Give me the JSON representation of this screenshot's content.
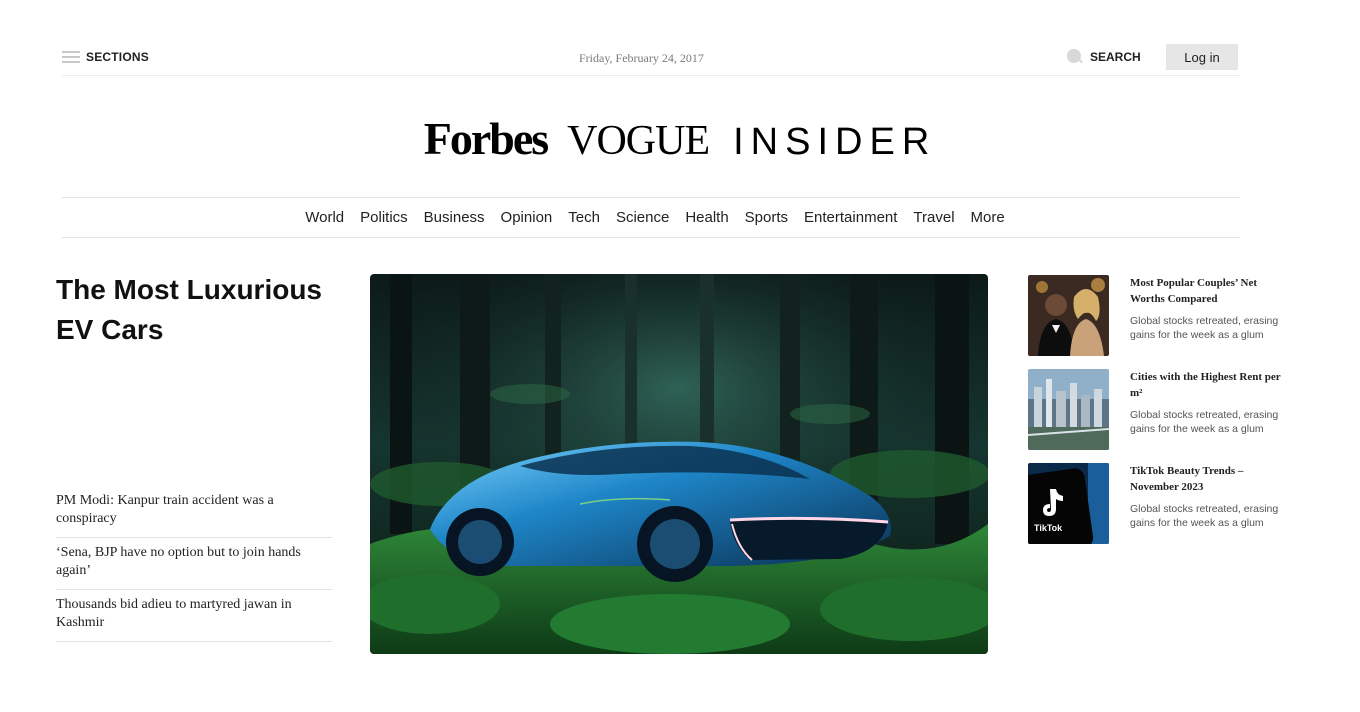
{
  "topbar": {
    "sections_label": "SECTIONS",
    "date": "Friday, February 24, 2017",
    "search_label": "SEARCH",
    "login_label": "Log in"
  },
  "logos": {
    "forbes": "Forbes",
    "vogue": "VOGUE",
    "insider": "INSIDER"
  },
  "nav": {
    "items": [
      "World",
      "Politics",
      "Business",
      "Opinion",
      "Tech",
      "Science",
      "Health",
      "Sports",
      "Entertainment",
      "Travel",
      "More"
    ]
  },
  "main": {
    "headline": "The Most Luxurious EV Cars",
    "hero_image": "futuristic-blue-car-in-forest"
  },
  "side_list": {
    "items": [
      "PM Modi: Kanpur train accident was a conspiracy",
      "‘Sena, BJP have no option but to join hands again’",
      "Thousands bid adieu to martyred jawan in Kashmir"
    ]
  },
  "cards": [
    {
      "title": "Most Popular Couples’ Net Worths Compared",
      "desc": "Global stocks retreated, erasing gains for the week as a glum",
      "thumb": "celebrity-couple-photo"
    },
    {
      "title": "Cities with the Highest Rent per m²",
      "desc": "Global stocks retreated, erasing gains for the week as a glum",
      "thumb": "city-skyline-photo"
    },
    {
      "title": "TikTok Beauty Trends – November 2023",
      "desc": "Global stocks retreated, erasing gains for the week as a glum",
      "thumb": "tiktok-logo-phone",
      "thumb_label": "TikTok"
    }
  ]
}
